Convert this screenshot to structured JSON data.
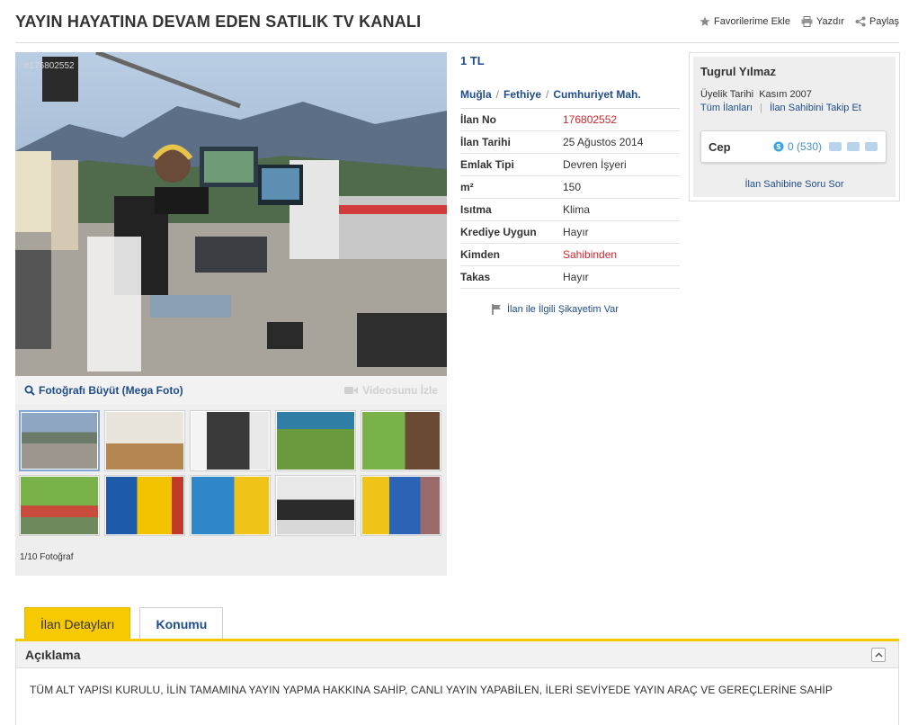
{
  "header": {
    "title": "YAYIN HAYATINA DEVAM EDEN SATILIK TV KANALI",
    "actions": [
      {
        "label": "Favorilerime Ekle",
        "icon": "star-icon"
      },
      {
        "label": "Yazdır",
        "icon": "printer-icon"
      },
      {
        "label": "Paylaş",
        "icon": "share-icon"
      }
    ]
  },
  "gallery": {
    "photo_id": "#176802552",
    "enlarge_label": "Fotoğrafı Büyüt (Mega Foto)",
    "video_label": "Videosunu İzle",
    "photo_count": "1/10 Fotoğraf",
    "thumbs": 10
  },
  "details": {
    "price": "1 TL",
    "location": [
      "Muğla",
      "Fethiye",
      "Cumhuriyet Mah."
    ],
    "rows": [
      {
        "label": "İlan No",
        "value": "176802552",
        "red": true
      },
      {
        "label": "İlan Tarihi",
        "value": "25 Ağustos 2014",
        "red": false
      },
      {
        "label": "Emlak Tipi",
        "value": "Devren İşyeri",
        "red": false
      },
      {
        "label": "m²",
        "value": "150",
        "red": false
      },
      {
        "label": "Isıtma",
        "value": "Klima",
        "red": false
      },
      {
        "label": "Krediye Uygun",
        "value": "Hayır",
        "red": false
      },
      {
        "label": "Kimden",
        "value": "Sahibinden",
        "red": true
      },
      {
        "label": "Takas",
        "value": "Hayır",
        "red": false
      }
    ],
    "complaint_label": "İlan ile İlgili Şikayetim Var"
  },
  "seller": {
    "name": "Tugrul Yılmaz",
    "since_label": "Üyelik Tarihi",
    "since_value": "Kasım 2007",
    "all_listings": "Tüm İlanları",
    "follow": "İlan Sahibini Takip Et",
    "cep_label": "Cep",
    "cep_value": "0 (530)",
    "ask": "İlan Sahibine Soru Sor"
  },
  "tabs": [
    {
      "label": "İlan Detayları",
      "active": true
    },
    {
      "label": "Konumu",
      "active": false
    }
  ],
  "description": {
    "title": "Açıklama",
    "text": "TÜM ALT YAPISI KURULU, İLİN TAMAMINA YAYIN YAPMA HAKKINA SAHİP, CANLI YAYIN YAPABİLEN, İLERİ SEVİYEDE YAYIN ARAÇ VE GEREÇLERİNE SAHİP"
  }
}
